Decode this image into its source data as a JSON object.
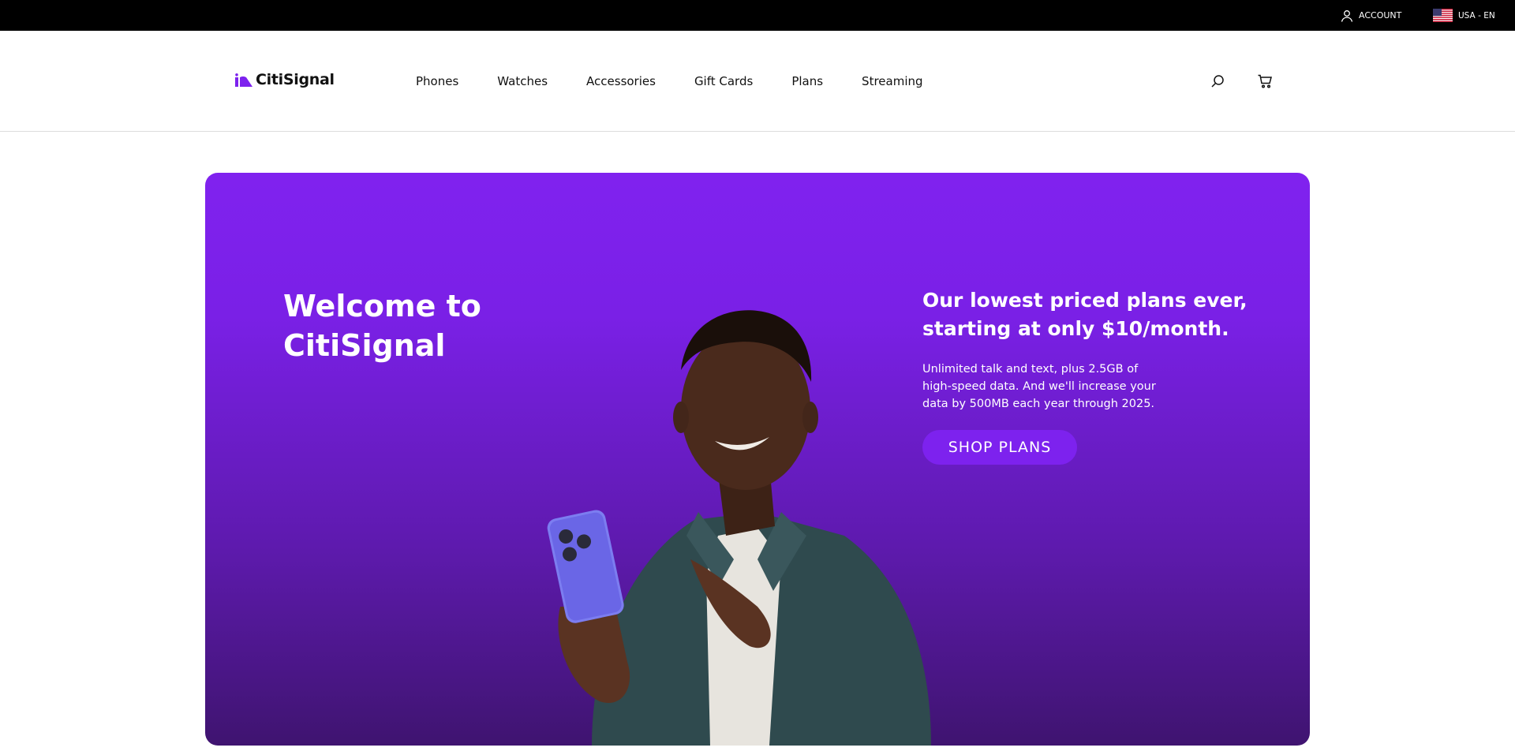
{
  "topbar": {
    "account_label": "ACCOUNT",
    "locale_label": "USA - EN"
  },
  "header": {
    "logo_text": "CitiSignal",
    "nav": [
      "Phones",
      "Watches",
      "Accessories",
      "Gift Cards",
      "Plans",
      "Streaming"
    ],
    "icons": [
      "search-icon",
      "cart-icon"
    ]
  },
  "hero": {
    "title": "Welcome to CitiSignal",
    "headline": "Our lowest priced plans ever, starting at only $10/month.",
    "body": "Unlimited talk and text, plus 2.5GB of high-speed data. And we'll increase your data by 500MB each year through 2025.",
    "cta_label": "SHOP PLANS"
  },
  "colors": {
    "brand_purple": "#8022ef",
    "button_purple": "#7d22ee",
    "topbar_bg": "#000000"
  }
}
